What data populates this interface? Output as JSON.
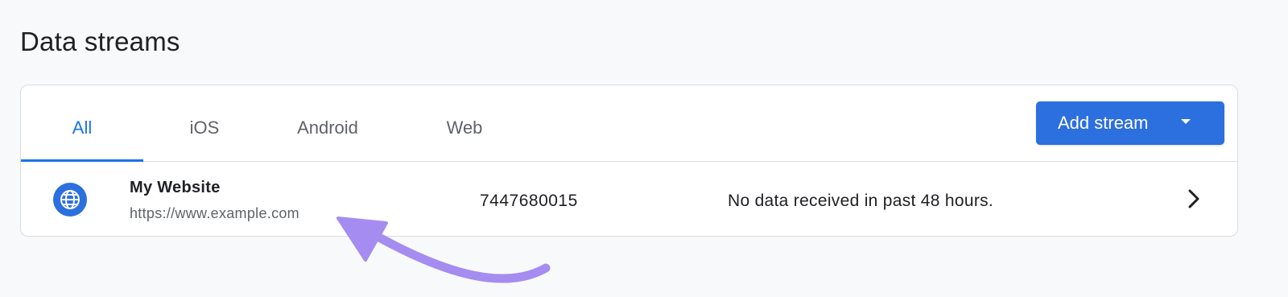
{
  "page": {
    "title": "Data streams"
  },
  "tabs": [
    {
      "label": "All",
      "active": true
    },
    {
      "label": "iOS",
      "active": false
    },
    {
      "label": "Android",
      "active": false
    },
    {
      "label": "Web",
      "active": false
    }
  ],
  "toolbar": {
    "add_stream_label": "Add stream"
  },
  "streams": [
    {
      "icon": "globe-icon",
      "name": "My Website",
      "url": "https://www.example.com",
      "id": "7447680015",
      "status": "No data received in past 48 hours."
    }
  ],
  "colors": {
    "accent": "#1a73e8",
    "button": "#2c6fde",
    "annotation": "#a58cf0"
  }
}
